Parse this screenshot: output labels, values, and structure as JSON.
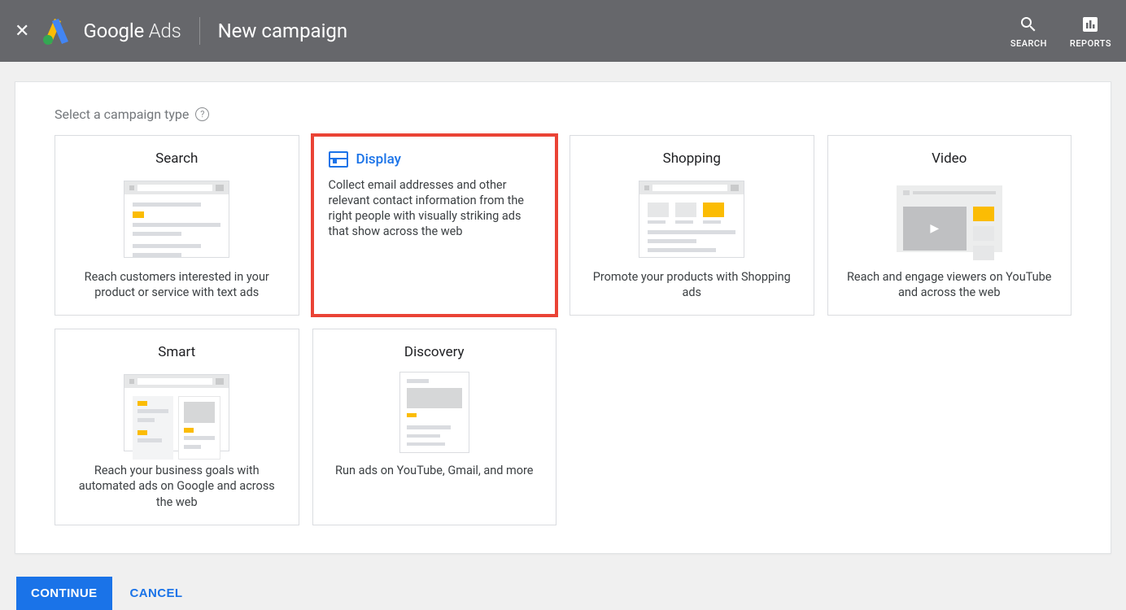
{
  "header": {
    "product": {
      "google": "Google",
      "ads": " Ads"
    },
    "page_title": "New campaign",
    "search_label": "SEARCH",
    "reports_label": "REPORTS"
  },
  "section_title": "Select a campaign type",
  "types": {
    "search": {
      "title": "Search",
      "desc": "Reach customers interested in your product or service with text ads"
    },
    "display": {
      "title": "Display",
      "desc": "Collect email addresses and other relevant contact information from the right people with visually striking ads that show across the web"
    },
    "shopping": {
      "title": "Shopping",
      "desc": "Promote your products with Shopping ads"
    },
    "video": {
      "title": "Video",
      "desc": "Reach and engage viewers on YouTube and across the web"
    },
    "smart": {
      "title": "Smart",
      "desc": "Reach your business goals with automated ads on Google and across the web"
    },
    "discovery": {
      "title": "Discovery",
      "desc": "Run ads on YouTube, Gmail, and more"
    }
  },
  "actions": {
    "continue": "CONTINUE",
    "cancel": "CANCEL"
  }
}
